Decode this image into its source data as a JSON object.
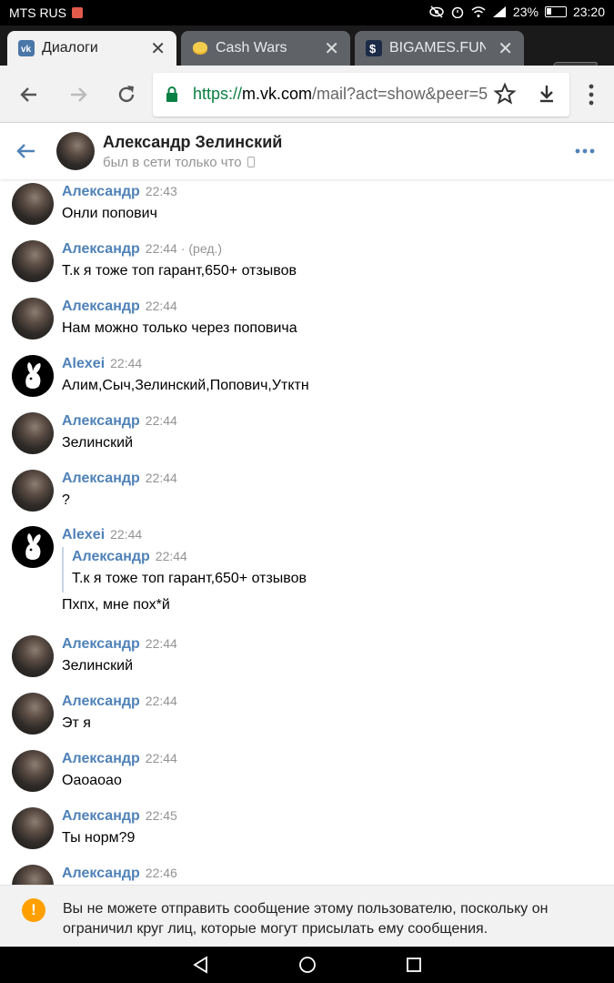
{
  "status_bar": {
    "carrier": "MTS RUS",
    "battery": "23%",
    "time": "23:20"
  },
  "tabs": [
    {
      "title": "Диалоги",
      "favicon": "vk-icon",
      "color": "#4a76a8",
      "active": true
    },
    {
      "title": "Cash Wars",
      "favicon": "coin-icon",
      "color": "#e9b32e",
      "active": false
    },
    {
      "title": "BIGAMES.FUN - $",
      "favicon": "dollar-icon",
      "color": "#1b2a47",
      "active": false
    }
  ],
  "toolbar": {
    "url_scheme": "https://",
    "url_host": "m.vk.com",
    "url_path": "/mail?act=show&peer=5"
  },
  "chat": {
    "name": "Александр Зелинский",
    "status": "был в сети только что"
  },
  "messages": [
    {
      "author": "Александр",
      "time": "22:43",
      "edited": "",
      "text": "Онли попович",
      "avatar": "alex"
    },
    {
      "author": "Александр",
      "time": "22:44",
      "edited": "· (ред.)",
      "text": "Т.к я тоже топ гарант,650+ отзывов",
      "avatar": "alex"
    },
    {
      "author": "Александр",
      "time": "22:44",
      "edited": "",
      "text": "Нам можно только через поповича",
      "avatar": "alex"
    },
    {
      "author": "Alexei",
      "time": "22:44",
      "edited": "",
      "text": "Алим,Сыч,Зелинский,Попович,Утктн",
      "avatar": "alexei"
    },
    {
      "author": "Александр",
      "time": "22:44",
      "edited": "",
      "text": "Зелинский",
      "avatar": "alex"
    },
    {
      "author": "Александр",
      "time": "22:44",
      "edited": "",
      "text": "?",
      "avatar": "alex"
    },
    {
      "author": "Alexei",
      "time": "22:44",
      "edited": "",
      "text": "Пхпх, мне пох*й",
      "avatar": "alexei",
      "quote": {
        "author": "Александр",
        "time": "22:44",
        "text": "Т.к я тоже топ гарант,650+ отзывов"
      }
    },
    {
      "author": "Александр",
      "time": "22:44",
      "edited": "",
      "text": "Зелинский",
      "avatar": "alex"
    },
    {
      "author": "Александр",
      "time": "22:44",
      "edited": "",
      "text": "Эт я",
      "avatar": "alex"
    },
    {
      "author": "Александр",
      "time": "22:44",
      "edited": "",
      "text": "Оаоаоао",
      "avatar": "alex"
    },
    {
      "author": "Александр",
      "time": "22:45",
      "edited": "",
      "text": "Ты норм?9",
      "avatar": "alex"
    },
    {
      "author": "Александр",
      "time": "22:46",
      "edited": "",
      "text": "",
      "avatar": "alex"
    }
  ],
  "notice": {
    "text": "Вы не можете отправить сообщение этому пользователю, поскольку он ограничил круг лиц, которые могут присылать ему сообщения.",
    "icon": "!"
  },
  "colors": {
    "accent": "#4f82b8",
    "secure": "#0b8043",
    "warning": "#ffa000"
  }
}
